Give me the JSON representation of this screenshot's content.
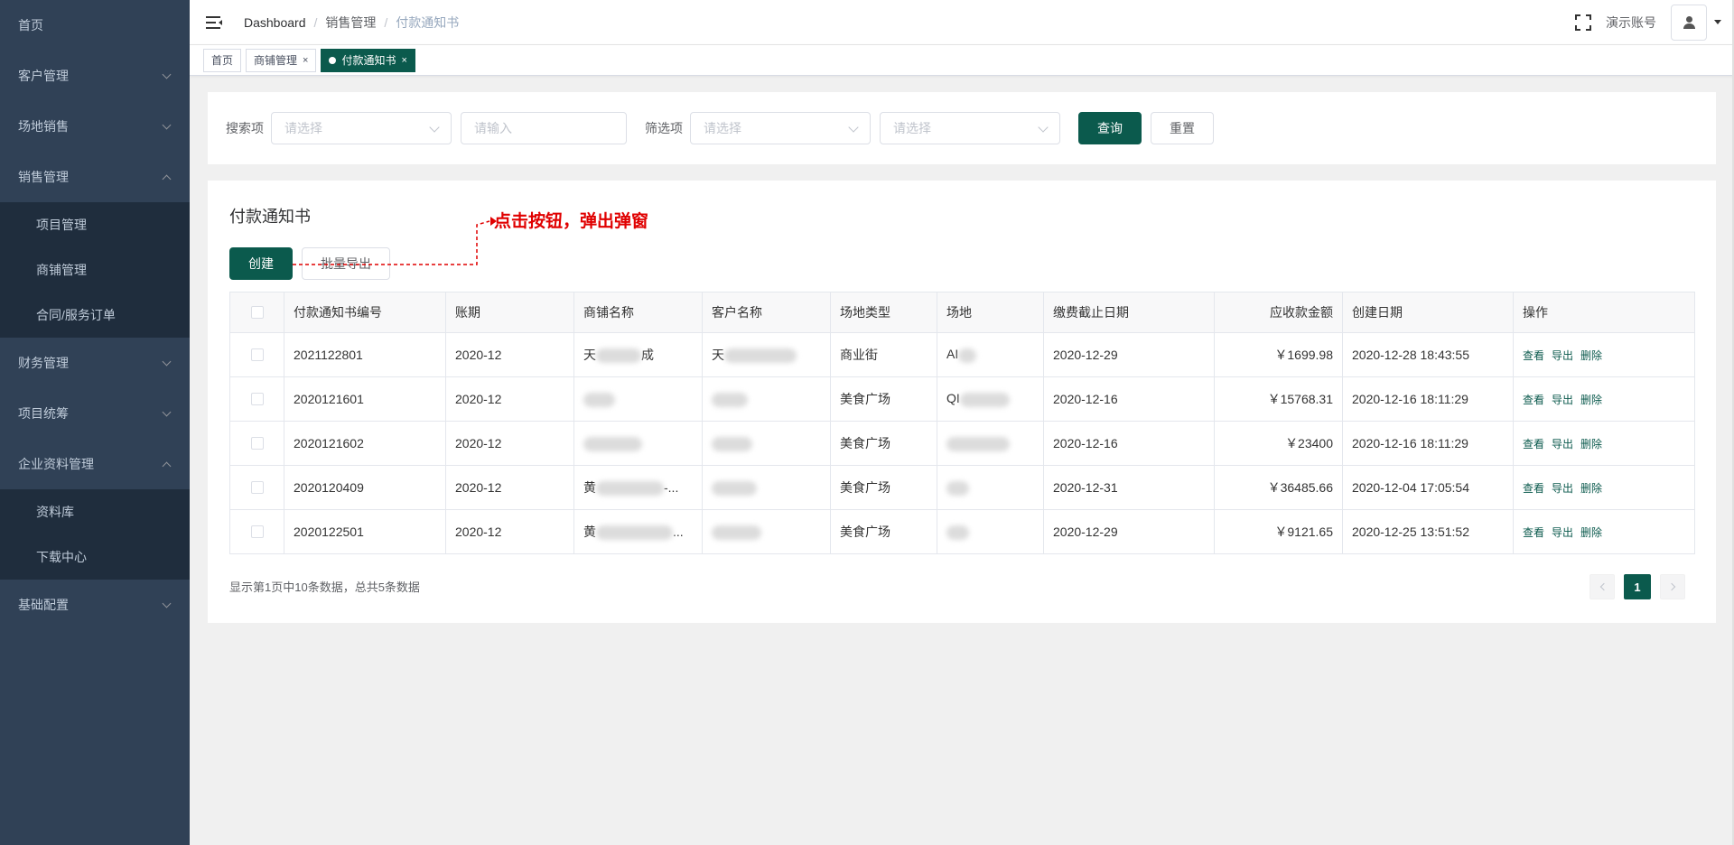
{
  "sidebar": {
    "items": [
      {
        "label": "首页"
      },
      {
        "label": "客户管理"
      },
      {
        "label": "场地销售"
      },
      {
        "label": "销售管理",
        "children": [
          "项目管理",
          "商铺管理",
          "合同/服务订单"
        ]
      },
      {
        "label": "财务管理"
      },
      {
        "label": "项目统筹"
      },
      {
        "label": "企业资料管理",
        "children": [
          "资料库",
          "下载中心"
        ]
      },
      {
        "label": "基础配置"
      }
    ]
  },
  "topbar": {
    "breadcrumb": [
      "Dashboard",
      "销售管理",
      "付款通知书"
    ],
    "account": "演示账号"
  },
  "tags": [
    {
      "label": "首页"
    },
    {
      "label": "商铺管理"
    },
    {
      "label": "付款通知书"
    }
  ],
  "search": {
    "search_label": "搜索项",
    "search_select_placeholder": "请选择",
    "search_input_placeholder": "请输入",
    "filter_label": "筛选项",
    "filter_select1_placeholder": "请选择",
    "filter_select2_placeholder": "请选择",
    "query_button": "查询",
    "reset_button": "重置"
  },
  "list": {
    "title": "付款通知书",
    "create_button": "创建",
    "export_button": "批量导出",
    "annotation": "点击按钮，弹出弹窗",
    "columns": [
      "付款通知书编号",
      "账期",
      "商铺名称",
      "客户名称",
      "场地类型",
      "场地",
      "缴费截止日期",
      "应收款金额",
      "创建日期",
      "操作"
    ],
    "rows": [
      {
        "id": "2021122801",
        "period": "2020-12",
        "shop_a": "天",
        "shop_b": "成",
        "customer": "天",
        "type": "商业街",
        "venue": "AI",
        "deadline": "2020-12-29",
        "amount": "￥1699.98",
        "created": "2020-12-28 18:43:55"
      },
      {
        "id": "2020121601",
        "period": "2020-12",
        "shop_a": "",
        "shop_b": "",
        "customer": "",
        "type": "美食广场",
        "venue": "QI",
        "deadline": "2020-12-16",
        "amount": "￥15768.31",
        "created": "2020-12-16 18:11:29"
      },
      {
        "id": "2020121602",
        "period": "2020-12",
        "shop_a": "",
        "shop_b": "",
        "customer": "",
        "type": "美食广场",
        "venue": "",
        "deadline": "2020-12-16",
        "amount": "￥23400",
        "created": "2020-12-16 18:11:29"
      },
      {
        "id": "2020120409",
        "period": "2020-12",
        "shop_a": "黄",
        "shop_b": "-...",
        "customer": "",
        "type": "美食广场",
        "venue": "",
        "deadline": "2020-12-31",
        "amount": "￥36485.66",
        "created": "2020-12-04 17:05:54"
      },
      {
        "id": "2020122501",
        "period": "2020-12",
        "shop_a": "黄",
        "shop_b": "...",
        "customer": "",
        "type": "美食广场",
        "venue": "",
        "deadline": "2020-12-29",
        "amount": "￥9121.65",
        "created": "2020-12-25 13:51:52"
      }
    ],
    "ops": [
      "查看",
      "导出",
      "删除"
    ]
  },
  "pagination": {
    "info": "显示第1页中10条数据，总共5条数据",
    "current": "1"
  },
  "colors": {
    "sidebar_bg": "#304156",
    "submenu_bg": "#1f2d3d",
    "primary": "#0b5a4d",
    "annotation": "#e00000"
  }
}
